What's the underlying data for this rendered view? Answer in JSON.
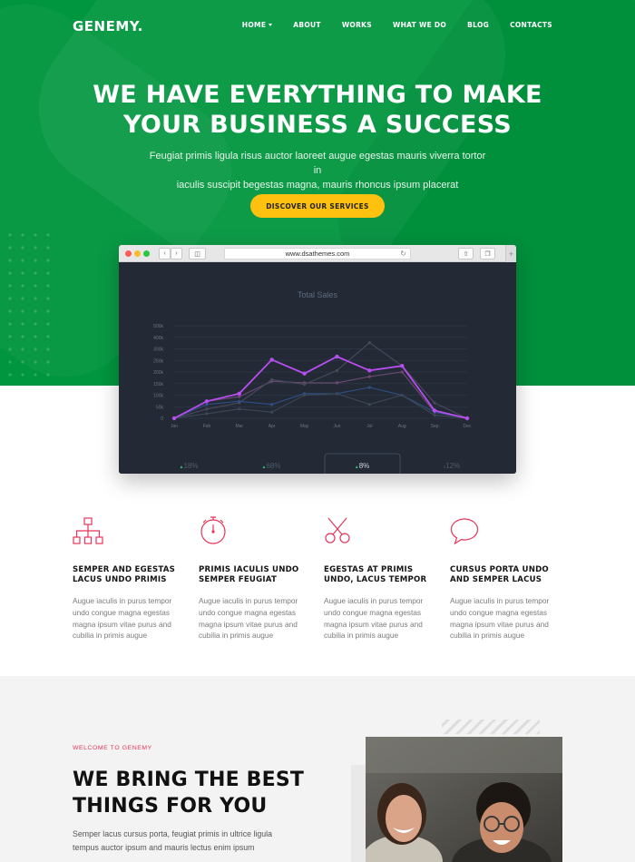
{
  "brand": {
    "logo": "GENEMY."
  },
  "nav": {
    "items": [
      "HOME",
      "ABOUT",
      "WORKS",
      "WHAT WE DO",
      "BLOG",
      "CONTACTS"
    ]
  },
  "hero": {
    "title_line1": "WE HAVE EVERYTHING TO MAKE",
    "title_line2": "YOUR BUSINESS A SUCCESS",
    "subtitle_line1": "Feugiat primis ligula risus auctor laoreet augue egestas mauris viverra tortor in",
    "subtitle_line2": "iaculis suscipit begestas magna, mauris rhoncus ipsum placerat",
    "cta_label": "DISCOVER OUR SERVICES"
  },
  "browser": {
    "url": "www.dsathemes.com"
  },
  "chart_data": {
    "type": "line",
    "title": "Total Sales",
    "categories": [
      "Jan",
      "Feb",
      "Mar",
      "Apr",
      "May",
      "Jun",
      "Jul",
      "Aug",
      "Sep",
      "Dec"
    ],
    "yticks": [
      "0",
      "50k",
      "100k",
      "150k",
      "200k",
      "250k",
      "300k",
      "400k",
      "500k"
    ],
    "ylim": [
      0,
      600
    ],
    "series": [
      {
        "values": [
          0,
          110,
          140,
          240,
          230,
          230,
          270,
          300,
          40,
          0
        ],
        "color": "#6d4a73"
      },
      {
        "values": [
          0,
          60,
          100,
          250,
          220,
          310,
          490,
          340,
          100,
          0
        ],
        "color": "#4a4a5c"
      },
      {
        "values": [
          0,
          90,
          110,
          90,
          160,
          160,
          200,
          150,
          40,
          0
        ],
        "color": "#2f4f85"
      },
      {
        "values": [
          0,
          30,
          60,
          40,
          150,
          160,
          90,
          150,
          20,
          0
        ],
        "color": "#3e4756"
      },
      {
        "values": [
          0,
          110,
          160,
          380,
          290,
          400,
          310,
          340,
          50,
          0
        ],
        "color": "#b84ef0"
      }
    ],
    "stats": [
      {
        "arrow": "▲",
        "value": "18%"
      },
      {
        "arrow": "▲",
        "value": "68%"
      },
      {
        "arrow": "▲",
        "value": "8%"
      },
      {
        "arrow": "↑",
        "value": "12%"
      }
    ]
  },
  "features": [
    {
      "icon": "sitemap-icon",
      "title_line1": "SEMPER AND EGESTAS",
      "title_line2": "LACUS UNDO PRIMIS",
      "text_lines": [
        "Augue iaculis in purus tempor",
        "undo congue magna egestas",
        "magna ipsum vitae purus and",
        "cubilia in primis augue"
      ]
    },
    {
      "icon": "stopwatch-icon",
      "title_line1": "PRIMIS IACULIS UNDO",
      "title_line2": "SEMPER FEUGIAT",
      "text_lines": [
        "Augue iaculis in purus tempor",
        "undo congue magna egestas",
        "magna ipsum vitae purus and",
        "cubilia in primis augue"
      ]
    },
    {
      "icon": "scissors-icon",
      "title_line1": "EGESTAS AT PRIMIS",
      "title_line2": "UNDO, LACUS TEMPOR",
      "text_lines": [
        "Augue iaculis in purus tempor",
        "undo congue magna egestas",
        "magna ipsum vitae purus and",
        "cubilia in primis augue"
      ]
    },
    {
      "icon": "speech-bubble-icon",
      "title_line1": "CURSUS PORTA UNDO",
      "title_line2": "AND SEMPER LACUS",
      "text_lines": [
        "Augue iaculis in purus tempor",
        "undo congue magna egestas",
        "magna ipsum vitae purus and",
        "cubilia in primis augue"
      ]
    }
  ],
  "about": {
    "eyebrow": "WELCOME TO GENEMY",
    "title_line1": "WE BRING THE BEST",
    "title_line2": "THINGS FOR YOU",
    "text_line1": "Semper lacus cursus porta, feugiat primis in ultrice ligula",
    "text_line2": "tempus auctor ipsum and mauris lectus enim ipsum"
  },
  "colors": {
    "brand_green": "#00963f",
    "cta_yellow": "#fec10f",
    "accent_pink": "#e5345a",
    "chart_bg": "#232a36"
  }
}
